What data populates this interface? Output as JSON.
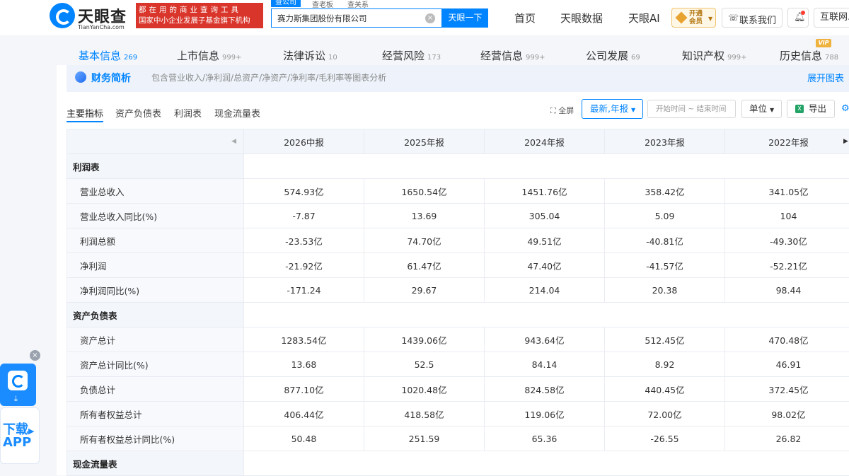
{
  "header": {
    "logo_cn": "天眼查",
    "logo_en": "TianYanCha.com",
    "slogan_line1": "都在用的商业查询工具",
    "slogan_line2": "国家中小企业发展子基金旗下机构",
    "search_tabs": [
      "查公司",
      "查老板",
      "查关系"
    ],
    "search_value": "赛力斯集团股份有限公司",
    "search_button": "天眼一下",
    "nav": [
      "首页",
      "天眼数据",
      "天眼AI"
    ],
    "vip_line1": "开通",
    "vip_line2": "会员",
    "contact": "联系我们",
    "network": "互联网..."
  },
  "category_tabs": [
    {
      "label": "基本信息",
      "count": "269"
    },
    {
      "label": "上市信息",
      "count": "999+"
    },
    {
      "label": "法律诉讼",
      "count": "10"
    },
    {
      "label": "经营风险",
      "count": "173"
    },
    {
      "label": "经营信息",
      "count": "999+"
    },
    {
      "label": "公司发展",
      "count": "69"
    },
    {
      "label": "知识产权",
      "count": "999+"
    },
    {
      "label": "历史信息",
      "count": "788"
    }
  ],
  "vip_tag": "VIP",
  "section": {
    "title": "财务简析",
    "description": "包含营业收入/净利润/总资产/净资产/净利率/毛利率等图表分析",
    "expand": "展开图表"
  },
  "sub_tabs": [
    "主要指标",
    "资产负债表",
    "利润表",
    "现金流量表"
  ],
  "toolbar": {
    "fullscreen": "全屏",
    "period_select": "最新,年报",
    "date_range": "开始时间 ~ 结束时间",
    "unit": "单位",
    "export": "导出"
  },
  "table": {
    "columns": [
      "2026中报",
      "2025年报",
      "2024年报",
      "2023年报",
      "2022年报"
    ],
    "groups": [
      {
        "name": "利润表",
        "rows": [
          {
            "label": "营业总收入",
            "values": [
              "574.93亿",
              "1650.54亿",
              "1451.76亿",
              "358.42亿",
              "341.05亿"
            ]
          },
          {
            "label": "营业总收入同比(%)",
            "values": [
              "-7.87",
              "13.69",
              "305.04",
              "5.09",
              "104"
            ]
          },
          {
            "label": "利润总额",
            "values": [
              "-23.53亿",
              "74.70亿",
              "49.51亿",
              "-40.81亿",
              "-49.30亿"
            ]
          },
          {
            "label": "净利润",
            "values": [
              "-21.92亿",
              "61.47亿",
              "47.40亿",
              "-41.57亿",
              "-52.21亿"
            ]
          },
          {
            "label": "净利润同比(%)",
            "values": [
              "-171.24",
              "29.67",
              "214.04",
              "20.38",
              "98.44"
            ]
          }
        ]
      },
      {
        "name": "资产负债表",
        "rows": [
          {
            "label": "资产总计",
            "values": [
              "1283.54亿",
              "1439.06亿",
              "943.64亿",
              "512.45亿",
              "470.48亿"
            ]
          },
          {
            "label": "资产总计同比(%)",
            "values": [
              "13.68",
              "52.5",
              "84.14",
              "8.92",
              "46.91"
            ]
          },
          {
            "label": "负债总计",
            "values": [
              "877.10亿",
              "1020.48亿",
              "824.58亿",
              "440.45亿",
              "372.45亿"
            ]
          },
          {
            "label": "所有者权益总计",
            "values": [
              "406.44亿",
              "418.58亿",
              "119.06亿",
              "72.00亿",
              "98.02亿"
            ]
          },
          {
            "label": "所有者权益总计同比(%)",
            "values": [
              "50.48",
              "251.59",
              "65.36",
              "-26.55",
              "26.82"
            ]
          }
        ]
      },
      {
        "name": "现金流量表",
        "rows": []
      }
    ]
  },
  "floating": {
    "download_line1": "下载",
    "download_line2": "APP"
  },
  "colors": {
    "brand_blue": "#0084ff",
    "slogan_red": "#d9352b",
    "vip_gold": "#f0b23e"
  }
}
